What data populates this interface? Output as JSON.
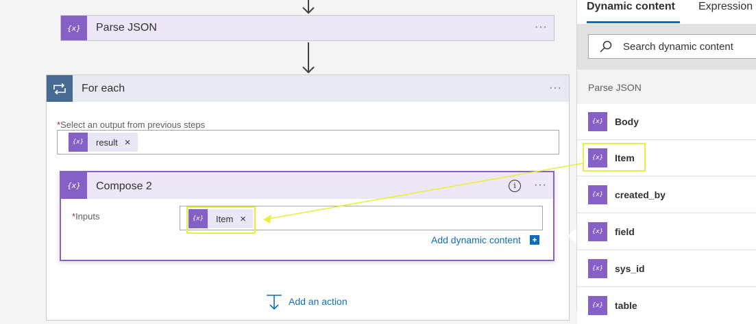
{
  "parse_json_card": {
    "title": "Parse JSON",
    "menu": "···",
    "icon": "{x}"
  },
  "for_each": {
    "title": "For each",
    "menu": "···",
    "field_required": "*",
    "field_label": "Select an output from previous steps",
    "token_label": "result",
    "token_remove": "×"
  },
  "compose": {
    "title": "Compose 2",
    "info": "i",
    "menu": "···",
    "inputs_required": "*",
    "inputs_label": "Inputs",
    "token_label": "Item",
    "token_remove": "×",
    "add_dynamic": "Add dynamic content",
    "add_dynamic_plus": "+"
  },
  "add_action": "Add an action",
  "panel": {
    "tabs": [
      "Dynamic content",
      "Expression"
    ],
    "search_placeholder": "Search dynamic content",
    "section_title": "Parse JSON",
    "items": [
      "Body",
      "Item",
      "created_by",
      "field",
      "sys_id",
      "table"
    ]
  },
  "colors": {
    "action_purple": "#8661c5",
    "loop_blue": "#486991",
    "link_blue": "#0f6cbd",
    "highlight_yellow": "#e8ef3c"
  }
}
